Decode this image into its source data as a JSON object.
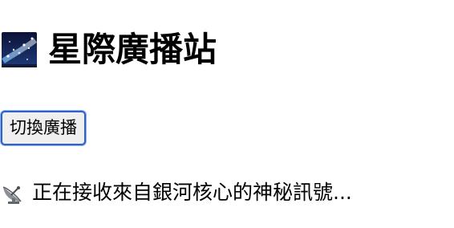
{
  "header": {
    "icon": "milky-way-icon",
    "title": "星際廣播站"
  },
  "controls": {
    "toggle_label": "切換廣播"
  },
  "status": {
    "icon": "satellite-dish-icon",
    "message": "正在接收來自銀河核心的神秘訊號..."
  },
  "colors": {
    "button_border": "#2f62c9",
    "button_background": "#efefef",
    "text": "#000000",
    "background": "#ffffff"
  }
}
